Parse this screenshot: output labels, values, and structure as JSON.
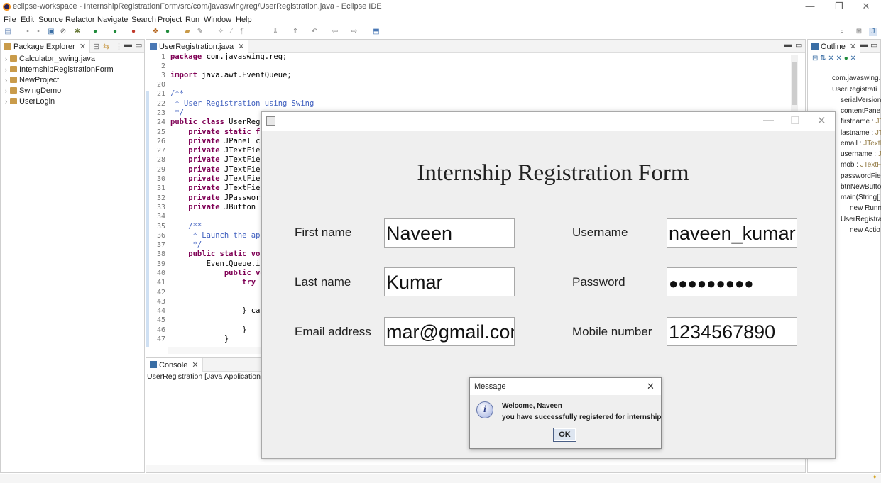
{
  "window": {
    "title": "eclipse-workspace - InternshipRegistrationForm/src/com/javaswing/reg/UserRegistration.java - Eclipse IDE",
    "minimize": "—",
    "restore": "❐",
    "close": "✕"
  },
  "menu": [
    "File",
    "Edit",
    "Source",
    "Refactor",
    "Navigate",
    "Search",
    "Project",
    "Run",
    "Window",
    "Help"
  ],
  "package_explorer": {
    "tab_label": "Package Explorer",
    "items": [
      "Calculator_swing.java",
      "InternshipRegistrationForm",
      "NewProject",
      "SwingDemo",
      "UserLogin"
    ]
  },
  "editor": {
    "tab_label": "UserRegistration.java",
    "line_numbers": [
      "1",
      "2",
      "3",
      "20",
      "21",
      "22",
      "23",
      "24",
      "25",
      "26",
      "27",
      "28",
      "29",
      "30",
      "31",
      "32",
      "33",
      "34",
      "35",
      "36",
      "37",
      "38",
      "39",
      "40",
      "41",
      "42",
      "43",
      "44",
      "45",
      "46",
      "47"
    ],
    "lines": [
      {
        "kw": "package",
        "text": " com.javaswing.reg;"
      },
      {
        "kw": "",
        "text": ""
      },
      {
        "kw": "import",
        "text": " java.awt.EventQueue;"
      },
      {
        "kw": "",
        "text": ""
      },
      {
        "cm": "/**"
      },
      {
        "cm": " * User Registration using Swing"
      },
      {
        "cm": " */"
      },
      {
        "kw": "public class",
        "text": " UserRegis"
      },
      {
        "kw": "    private static fin",
        "text": ""
      },
      {
        "kw": "    private",
        "text": " JPanel con"
      },
      {
        "kw": "    private",
        "text": " JTextField"
      },
      {
        "kw": "    private",
        "text": " JTextField"
      },
      {
        "kw": "    private",
        "text": " JTextField"
      },
      {
        "kw": "    private",
        "text": " JTextField"
      },
      {
        "kw": "    private",
        "text": " JTextField"
      },
      {
        "kw": "    private",
        "text": " JPasswordF"
      },
      {
        "kw": "    private",
        "text": " JButton bt"
      },
      {
        "kw": "",
        "text": ""
      },
      {
        "cm": "    /**"
      },
      {
        "cm": "     * Launch the appl"
      },
      {
        "cm": "     */"
      },
      {
        "kw": "    public static void",
        "text": ""
      },
      {
        "kw": "",
        "text": "        EventQueue.inv"
      },
      {
        "kw": "            public voi",
        "text": ""
      },
      {
        "kw": "                try",
        "text": " {"
      },
      {
        "kw": "",
        "text": "                    Us"
      },
      {
        "kw": "",
        "text": "                    fr"
      },
      {
        "kw": "",
        "text": "                } catc"
      },
      {
        "kw": "",
        "text": "                    e."
      },
      {
        "kw": "",
        "text": "                }"
      },
      {
        "kw": "",
        "text": "            }"
      }
    ]
  },
  "console": {
    "tab_label": "Console",
    "text": "UserRegistration [Java Application] C\\"
  },
  "outline": {
    "tab_label": "Outline",
    "items": [
      {
        "name": "com.javaswing.r",
        "type": ""
      },
      {
        "name": "UserRegistrati",
        "type": ""
      },
      {
        "name": "serialVersionU",
        "type": ""
      },
      {
        "name": "contentPane",
        "type": ""
      },
      {
        "name": "firstname : ",
        "type": "JT"
      },
      {
        "name": "lastname : ",
        "type": "JTe"
      },
      {
        "name": "email : ",
        "type": "JTextF"
      },
      {
        "name": "username : ",
        "type": "JT"
      },
      {
        "name": "mob : ",
        "type": "JTextFi"
      },
      {
        "name": "passwordFiel",
        "type": ""
      },
      {
        "name": "btnNewButto",
        "type": ""
      },
      {
        "name": "main(String[]",
        "type": ""
      },
      {
        "name": "new Runna",
        "type": ""
      },
      {
        "name": "UserRegistrat",
        "type": ""
      },
      {
        "name": "new Actio",
        "type": ""
      }
    ]
  },
  "form": {
    "title": "Internship Registration Form",
    "first_name_label": "First name",
    "first_name_value": "Naveen",
    "last_name_label": "Last name",
    "last_name_value": "Kumar",
    "email_label": "Email address",
    "email_value": "mar@gmail.com",
    "username_label": "Username",
    "username_value": "naveen_kumar",
    "password_label": "Password",
    "password_value": "●●●●●●●●●",
    "mobile_label": "Mobile number",
    "mobile_value": "1234567890"
  },
  "dialog": {
    "title": "Message",
    "line1": "Welcome, Naveen",
    "line2": "you have successfully registered for internship",
    "ok_label": "OK",
    "close": "✕",
    "info_glyph": "i"
  }
}
